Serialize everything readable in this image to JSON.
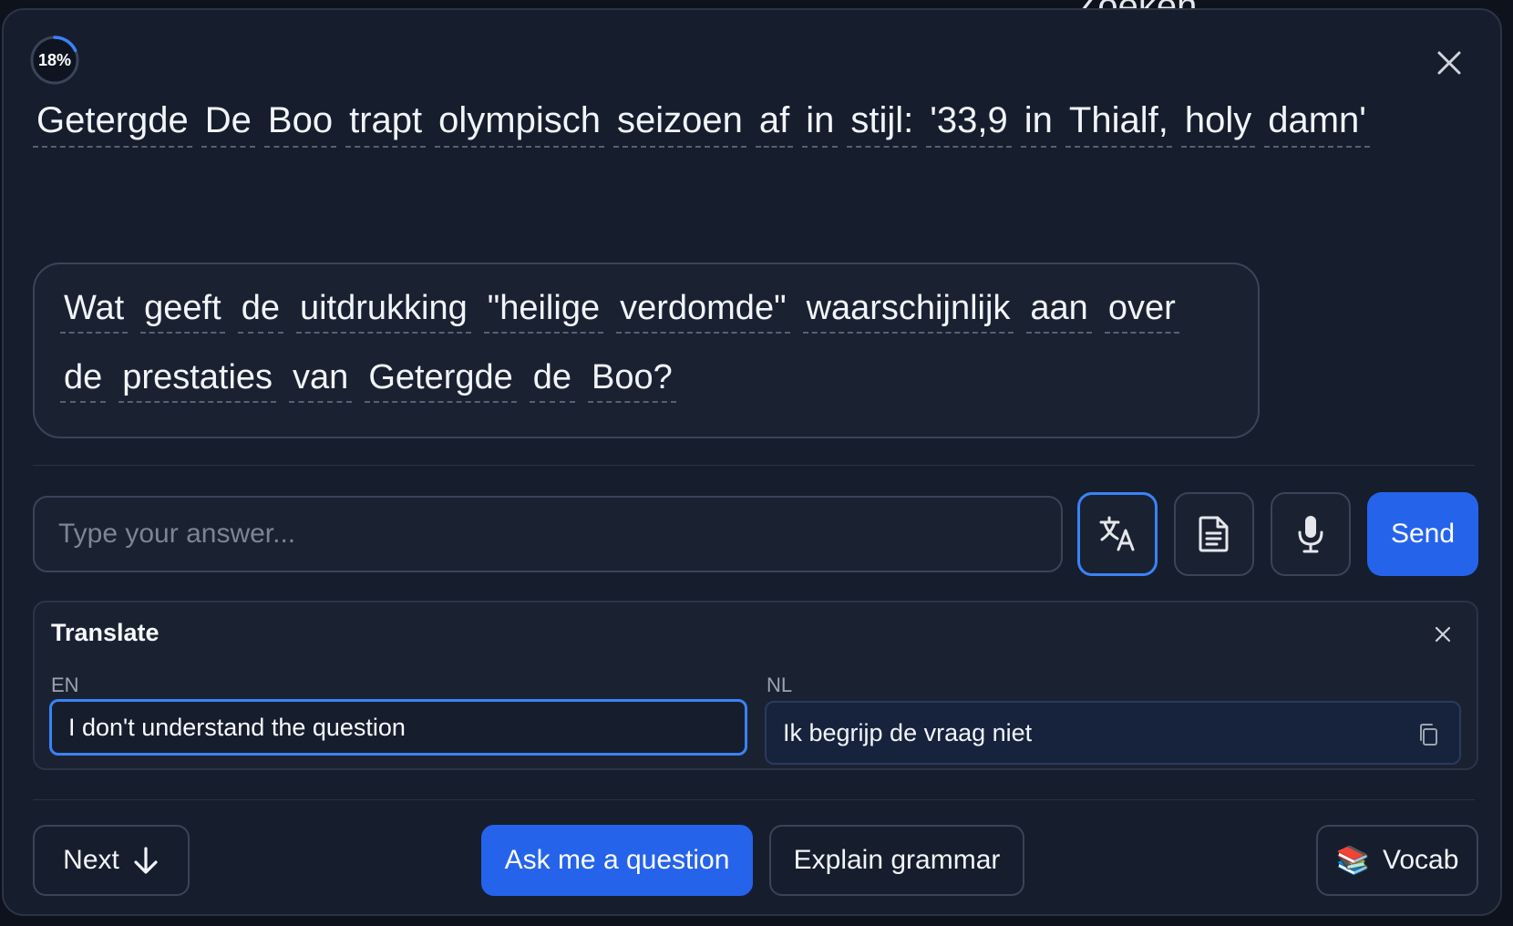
{
  "backdrop": {
    "top_text": "Zoeken"
  },
  "progress": {
    "label": "18%",
    "value": 0.18,
    "color": "#3b82f6"
  },
  "sentence": {
    "words": [
      "Getergde",
      "De",
      "Boo",
      "trapt",
      "olympisch",
      "seizoen",
      "af",
      "in",
      "stijl:",
      "'33,9",
      "in",
      "Thialf,",
      "holy",
      "damn'"
    ]
  },
  "question": {
    "words": [
      "Wat",
      "geeft",
      "de",
      "uitdrukking",
      "\"heilige",
      "verdomde\"",
      "waarschijnlijk",
      "aan",
      "over",
      "de",
      "prestaties",
      "van",
      "Getergde",
      "de",
      "Boo?"
    ]
  },
  "answer": {
    "placeholder": "Type your answer...",
    "value": ""
  },
  "toolbar": {
    "translate_icon": "translate-icon",
    "notes_icon": "document-icon",
    "mic_icon": "microphone-icon",
    "send_label": "Send"
  },
  "translate": {
    "title": "Translate",
    "source_lang": "EN",
    "target_lang": "NL",
    "source_text": "I don't understand the question",
    "target_text": "Ik begrijp de vraag niet"
  },
  "actions": {
    "next_label": "Next",
    "ask_label": "Ask me a question",
    "explain_label": "Explain grammar",
    "vocab_emoji": "📚",
    "vocab_label": "Vocab"
  },
  "colors": {
    "accent": "#2563eb",
    "panel_bg": "#161e2d",
    "text": "#f1f5f9"
  }
}
